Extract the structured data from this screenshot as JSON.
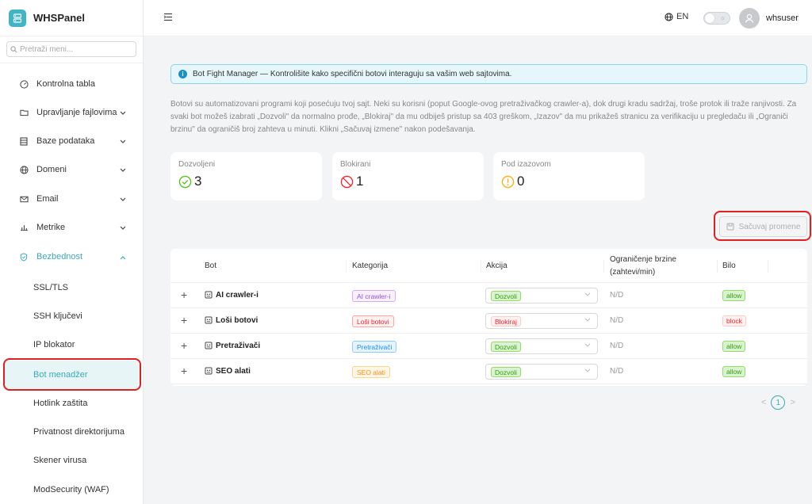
{
  "app": {
    "name": "WHSPanel"
  },
  "sidebar": {
    "search_placeholder": "Pretraži meni...",
    "items": [
      {
        "label": "Kontrolna tabla",
        "icon": "dashboard-icon"
      },
      {
        "label": "Upravljanje fajlovima",
        "icon": "folder-icon"
      },
      {
        "label": "Baze podataka",
        "icon": "database-icon"
      },
      {
        "label": "Domeni",
        "icon": "globe-icon"
      },
      {
        "label": "Email",
        "icon": "mail-icon"
      },
      {
        "label": "Metrike",
        "icon": "chart-icon"
      },
      {
        "label": "Bezbednost",
        "icon": "shield-icon"
      }
    ],
    "security_sub": [
      "SSL/TLS",
      "SSH ključevi",
      "IP blokator",
      "Bot menadžer",
      "Hotlink zaštita",
      "Privatnost direktorijuma",
      "Skener virusa",
      "ModSecurity (WAF)"
    ]
  },
  "header": {
    "lang": "EN",
    "username": "whsuser"
  },
  "main": {
    "alert": "Bot Fight Manager — Kontrolišite kako specifični botovi interaguju sa vašim web sajtovima.",
    "description": "Botovi su automatizovani programi koji posećuju tvoj sajt. Neki su korisni (poput Google-ovog pretraživačkog crawler-a), dok drugi kradu sadržaj, troše protok ili traže ranjivosti. Za svaki bot možeš izabrati „Dozvoli\" da normalno prođe, „Blokiraj\" da mu odbiješ pristup sa 403 greškom, „Izazov\" da mu prikažeš stranicu za verifikaciju u pregledaču ili „Ograniči brzinu\" da ograničiš broj zahteva u minuti. Klikni „Sačuvaj izmene\" nakon podešavanja.",
    "stats": [
      {
        "label": "Dozvoljeni",
        "value": "3",
        "color": "#52c41a"
      },
      {
        "label": "Blokirani",
        "value": "1",
        "color": "#f5222d"
      },
      {
        "label": "Pod izazovom",
        "value": "0",
        "color": "#faad14"
      }
    ],
    "save_label": "Sačuvaj promene",
    "table": {
      "headers": {
        "bot": "Bot",
        "category": "Kategorija",
        "action": "Akcija",
        "rate_line1": "Ograničenje brzine",
        "rate_line2": "(zahtevi/min)",
        "bilo": "Bilo"
      },
      "rows": [
        {
          "name": "AI crawler-i",
          "category": "AI crawler-i",
          "action": "Dozvoli",
          "rate": "N/D",
          "bilo": "allow"
        },
        {
          "name": "Loši botovi",
          "category": "Loši botovi",
          "action": "Blokiraj",
          "rate": "N/D",
          "bilo": "block"
        },
        {
          "name": "Pretraživači",
          "category": "Pretraživači",
          "action": "Dozvoli",
          "rate": "N/D",
          "bilo": "allow"
        },
        {
          "name": "SEO alati",
          "category": "SEO alati",
          "action": "Dozvoli",
          "rate": "N/D",
          "bilo": "allow"
        }
      ]
    },
    "pagination": {
      "current": "1"
    }
  },
  "colors": {
    "accent": "#3aa8b8",
    "cat_ai": "#9254de",
    "cat_bad": "#f5222d",
    "cat_search": "#1890ff",
    "cat_seo": "#fa8c16",
    "allow": "#52c41a",
    "block": "#f5222d"
  }
}
